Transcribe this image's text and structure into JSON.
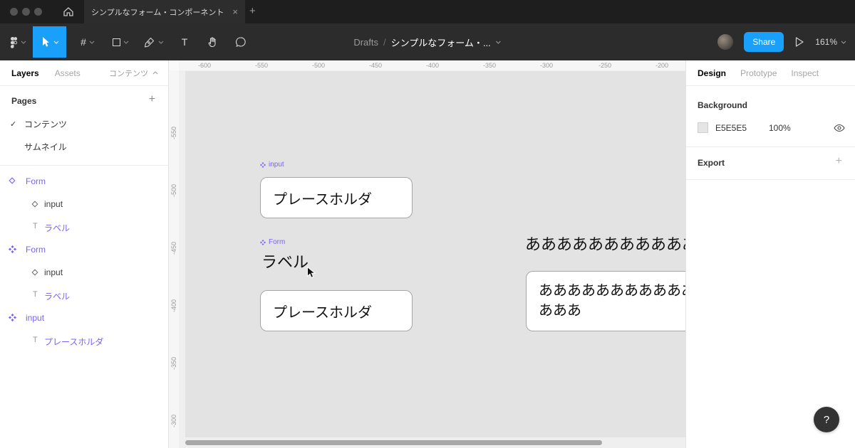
{
  "window": {
    "tab_title": "シンプルなフォーム・コンポーネント"
  },
  "icons": {
    "close": "×",
    "new_tab": "+",
    "frame_tool": "#",
    "text_tool": "T",
    "text_layer": "T",
    "check": "✓",
    "pages_add": "+",
    "export_add": "+",
    "help": "?"
  },
  "toolbar": {
    "breadcrumb_root": "Drafts",
    "breadcrumb_sep": "/",
    "breadcrumb_current": "シンプルなフォーム・...",
    "share": "Share",
    "zoom": "161%"
  },
  "left_panel": {
    "tab_layers": "Layers",
    "tab_assets": "Assets",
    "page_selector": "コンテンツ",
    "pages_header": "Pages",
    "pages": [
      {
        "label": "コンテンツ"
      },
      {
        "label": "サムネイル"
      }
    ],
    "layers": [
      {
        "label": "Form"
      },
      {
        "label": "input"
      },
      {
        "label": "ラベル"
      },
      {
        "label": "Form"
      },
      {
        "label": "input"
      },
      {
        "label": "ラベル"
      },
      {
        "label": "input"
      },
      {
        "label": "プレースホルダ"
      }
    ]
  },
  "canvas": {
    "ruler_top": [
      "-600",
      "-550",
      "-500",
      "-450",
      "-400",
      "-350",
      "-300",
      "-250",
      "-200"
    ],
    "ruler_left": [
      "-550",
      "-500",
      "-450",
      "-400",
      "-350",
      "-300"
    ],
    "input_component_label": "input",
    "form_component_label": "Form",
    "input_box_1_text": "プレースホルダ",
    "form_label_text": "ラベル",
    "input_box_2_text": "プレースホルダ",
    "overflow_text": "ああああああああああああ",
    "overflow_box_line_1": "あああああああああああああ",
    "overflow_box_line_2": "あああ"
  },
  "right_panel": {
    "tab_design": "Design",
    "tab_prototype": "Prototype",
    "tab_inspect": "Inspect",
    "background_header": "Background",
    "background_hex": "E5E5E5",
    "background_opacity": "100%",
    "export_header": "Export"
  },
  "colors": {
    "accent_blue": "#18A0FB",
    "component_purple": "#7B61FF",
    "canvas_bg": "#E5E5E5"
  }
}
